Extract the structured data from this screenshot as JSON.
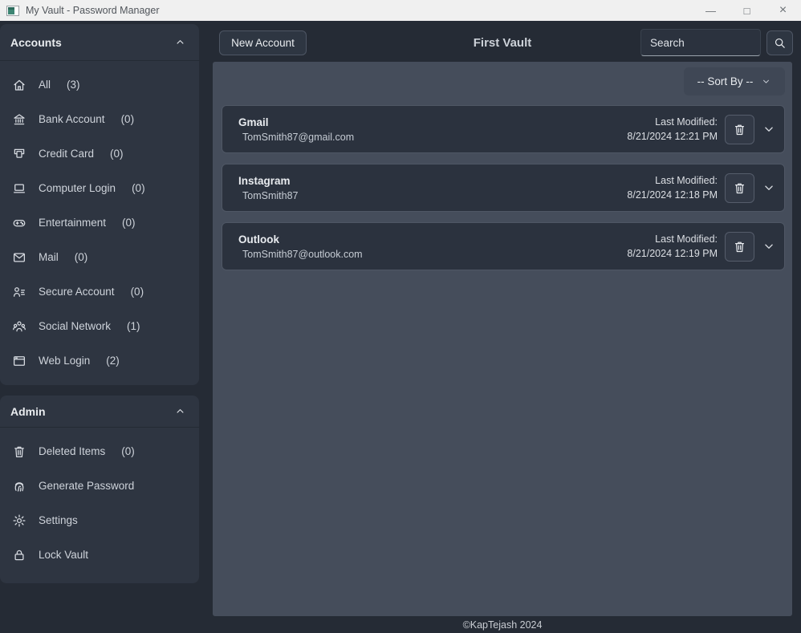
{
  "window": {
    "title": "My Vault - Password Manager",
    "minimize_glyph": "—",
    "maximize_glyph": "□",
    "close_glyph": "×"
  },
  "sidebar": {
    "accounts": {
      "header": "Accounts",
      "items": [
        {
          "icon": "home-icon",
          "label": "All",
          "count": "(3)"
        },
        {
          "icon": "bank-icon",
          "label": "Bank Account",
          "count": "(0)"
        },
        {
          "icon": "credit-card-icon",
          "label": "Credit Card",
          "count": "(0)"
        },
        {
          "icon": "computer-icon",
          "label": "Computer Login",
          "count": "(0)"
        },
        {
          "icon": "gamepad-icon",
          "label": "Entertainment",
          "count": "(0)"
        },
        {
          "icon": "mail-icon",
          "label": "Mail",
          "count": "(0)"
        },
        {
          "icon": "secure-account-icon",
          "label": "Secure Account",
          "count": "(0)"
        },
        {
          "icon": "social-network-icon",
          "label": "Social Network",
          "count": "(1)"
        },
        {
          "icon": "web-login-icon",
          "label": "Web Login",
          "count": "(2)"
        }
      ]
    },
    "admin": {
      "header": "Admin",
      "items": [
        {
          "icon": "trash-icon",
          "label": "Deleted Items",
          "count": "(0)"
        },
        {
          "icon": "fingerprint-icon",
          "label": "Generate Password",
          "count": ""
        },
        {
          "icon": "gear-icon",
          "label": "Settings",
          "count": ""
        },
        {
          "icon": "lock-icon",
          "label": "Lock Vault",
          "count": ""
        }
      ]
    }
  },
  "topbar": {
    "new_account_label": "New Account",
    "vault_title": "First Vault",
    "search_placeholder": "Search"
  },
  "main": {
    "sort_by_label": "-- Sort By --",
    "accounts": [
      {
        "name": "Gmail",
        "username": "TomSmith87@gmail.com",
        "modified_label": "Last Modified:",
        "modified_date": "8/21/2024 12:21 PM"
      },
      {
        "name": "Instagram",
        "username": "TomSmith87",
        "modified_label": "Last Modified:",
        "modified_date": "8/21/2024 12:18 PM"
      },
      {
        "name": "Outlook",
        "username": "TomSmith87@outlook.com",
        "modified_label": "Last Modified:",
        "modified_date": "8/21/2024 12:19 PM"
      }
    ]
  },
  "footer": {
    "copyright": "©KapTejash 2024"
  },
  "colors": {
    "titlebar_bg": "#f0f0f0",
    "page_bg": "#252b35",
    "sidebar_panel_bg": "#2e3541",
    "main_panel_bg": "#454d5b",
    "card_bg": "#2b323e",
    "card_border": "#4f5765",
    "button_bg": "#2e3642",
    "dropdown_bg": "#3f4755",
    "app_icon_teal": "#3d8573"
  }
}
